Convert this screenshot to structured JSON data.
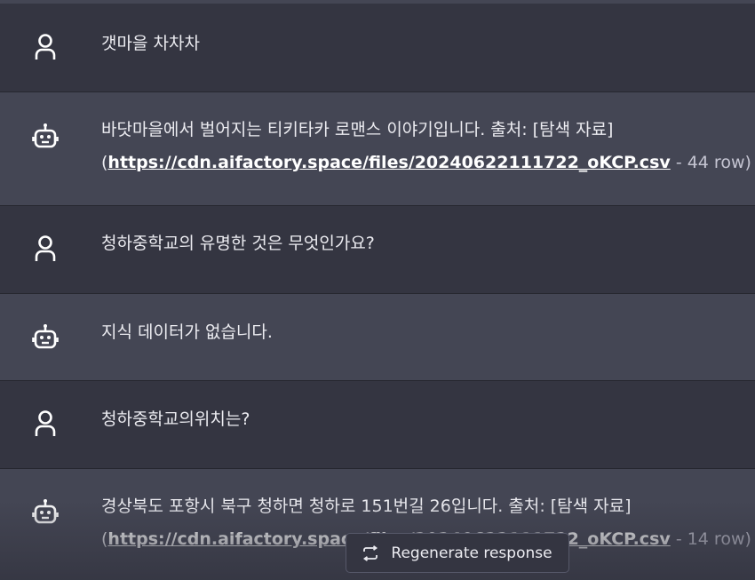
{
  "messages": [
    {
      "role": "user",
      "avatar_icon": "user-icon",
      "text": "갯마을 차차차"
    },
    {
      "role": "bot",
      "avatar_icon": "robot-icon",
      "text": "바닷마을에서 벌어지는 티키타카 로맨스 이야기입니다. 출처: [탐색 자료]",
      "link_open": "(",
      "link": "https://cdn.aifactory.space/files/20240622111722_oKCP.csv",
      "link_suffix": " - 44 row)"
    },
    {
      "role": "user",
      "avatar_icon": "user-icon",
      "text": "청하중학교의 유명한 것은 무엇인가요?"
    },
    {
      "role": "bot",
      "avatar_icon": "robot-icon",
      "text": "지식 데이터가 없습니다."
    },
    {
      "role": "user",
      "avatar_icon": "user-icon",
      "text": "청하중학교의위치는?"
    },
    {
      "role": "bot",
      "avatar_icon": "robot-icon",
      "text": "경상북도 포항시 북구 청하면 청하로 151번길 26입니다. 출처: [탐색 자료]",
      "link_open": "(",
      "link": "https://cdn.aifactory.space/files/20240622111722_oKCP.csv",
      "link_suffix": " - 14 row)"
    }
  ],
  "regenerate_label": "Regenerate response",
  "regenerate_icon": "refresh-icon",
  "colors": {
    "user_row": "#343541",
    "bot_row": "#444654",
    "text": "#ececf1",
    "muted": "#c5c5d2"
  }
}
